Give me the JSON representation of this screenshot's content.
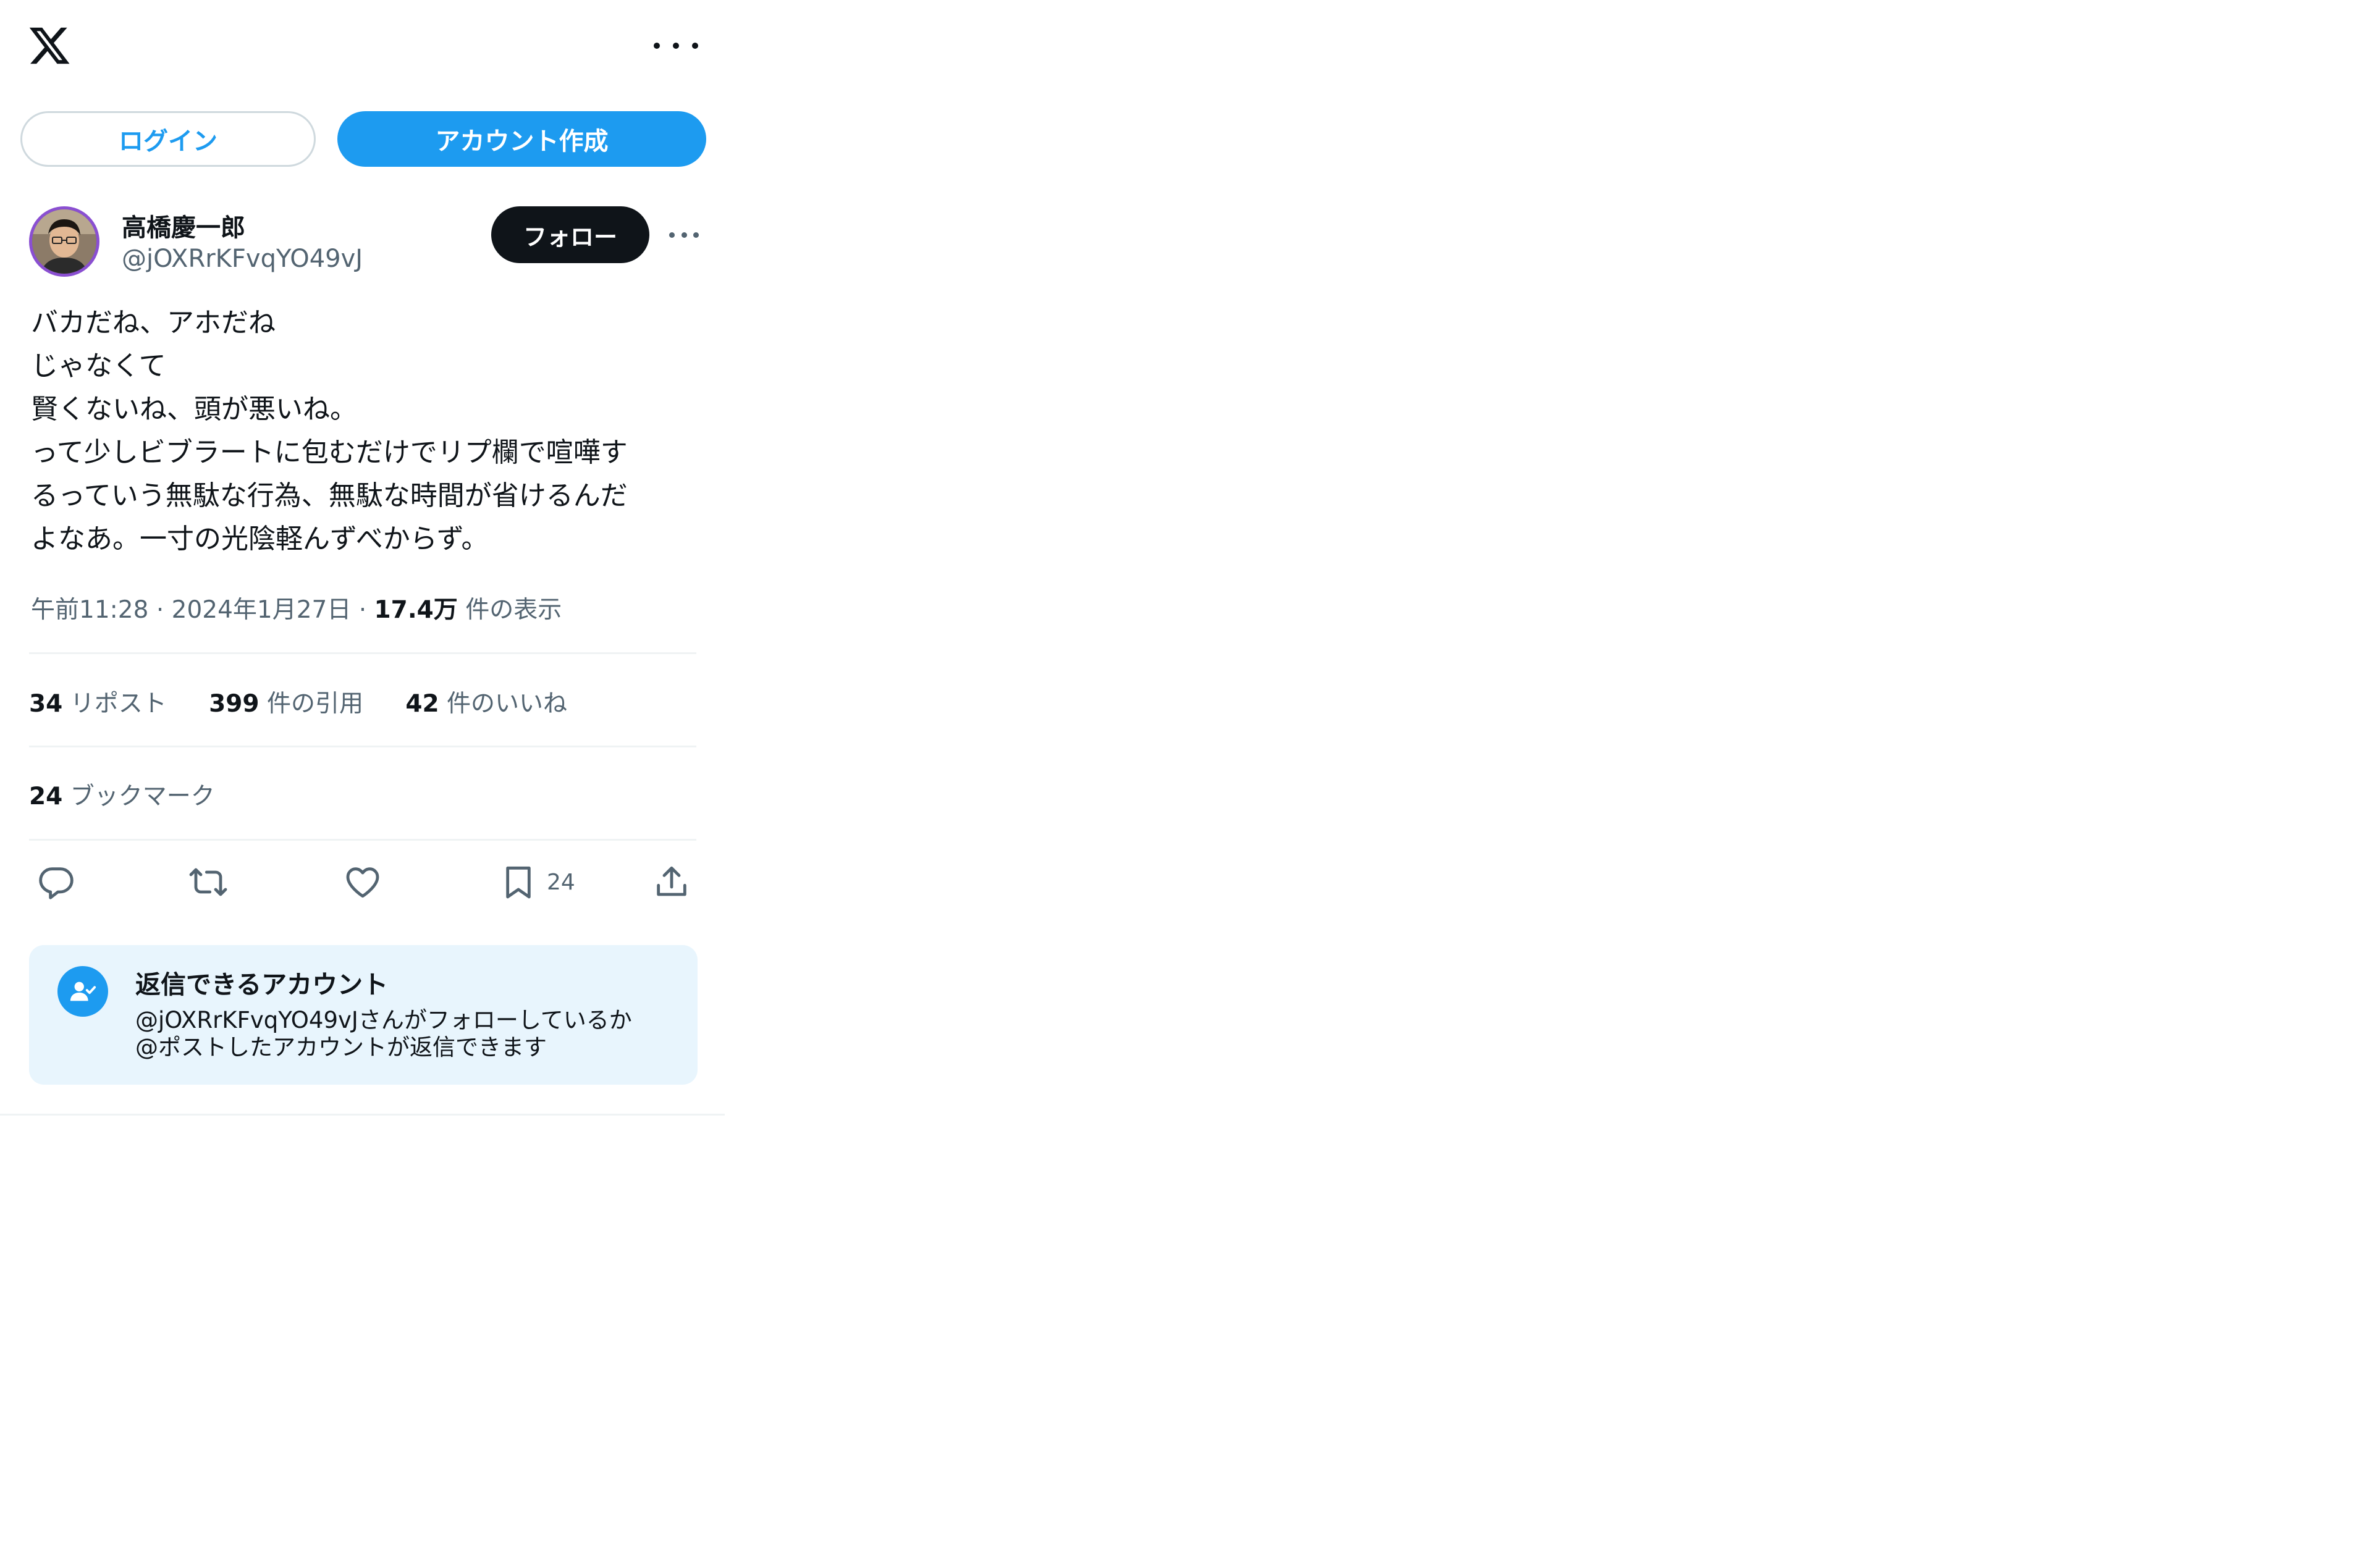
{
  "topbar": {
    "logo_icon": "x-logo-icon",
    "more_icon": "more-horizontal-icon"
  },
  "auth": {
    "login_label": "ログイン",
    "signup_label": "アカウント作成"
  },
  "author": {
    "name": "高橋慶一郎",
    "handle": "@jOXRrKFvqYO49vJ",
    "follow_label": "フォロー"
  },
  "tweet": {
    "text": "バカだね、アホだね\nじゃなくて\n賢くないね、頭が悪いね。\nって少しビブラートに包むだけでリプ欄で喧嘩す\nるっていう無駄な行為、無駄な時間が省けるんだ\nよなあ。一寸の光陰軽んずべからず。",
    "time": "午前11:28",
    "date": "2024年1月27日",
    "separator": "·",
    "views_count": "17.4万",
    "views_label": "件の表示"
  },
  "stats": {
    "reposts_count": "34",
    "reposts_label": "リポスト",
    "quotes_count": "399",
    "quotes_label": "件の引用",
    "likes_count": "42",
    "likes_label": "件のいいね",
    "bookmarks_count": "24",
    "bookmarks_label": "ブックマーク"
  },
  "actions": {
    "reply_icon": "reply-icon",
    "repost_icon": "repost-icon",
    "like_icon": "heart-icon",
    "bookmark_icon": "bookmark-icon",
    "bookmark_count": "24",
    "share_icon": "share-icon"
  },
  "reply_restriction": {
    "title": "返信できるアカウント",
    "line1": "@jOXRrKFvqYO49vJさんがフォローしているか",
    "line2": "@ポストしたアカウントが返信できます"
  },
  "colors": {
    "accent": "#1d9bf0",
    "text": "#0f1419",
    "secondary": "#536471",
    "divider": "#eff3f4",
    "info_bg": "#e8f5fd"
  }
}
